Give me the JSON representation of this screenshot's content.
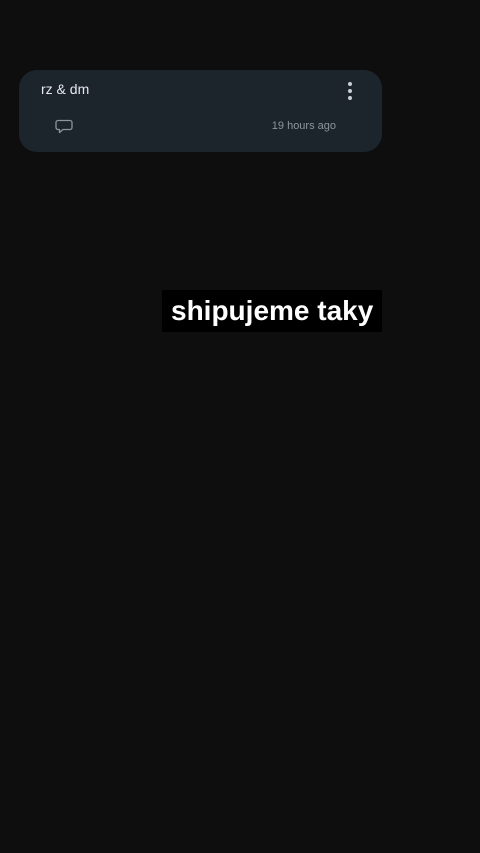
{
  "note": {
    "title": "rz & dm",
    "time": "19 hours ago",
    "menu_icon": "more-vert-icon",
    "comment_icon": "comment-icon"
  },
  "caption": {
    "text": "shipujeme taky"
  },
  "colors": {
    "background": "#0e0e0e",
    "card": "#1d252c",
    "caption_bg": "#000000",
    "caption_text": "#ffffff"
  }
}
